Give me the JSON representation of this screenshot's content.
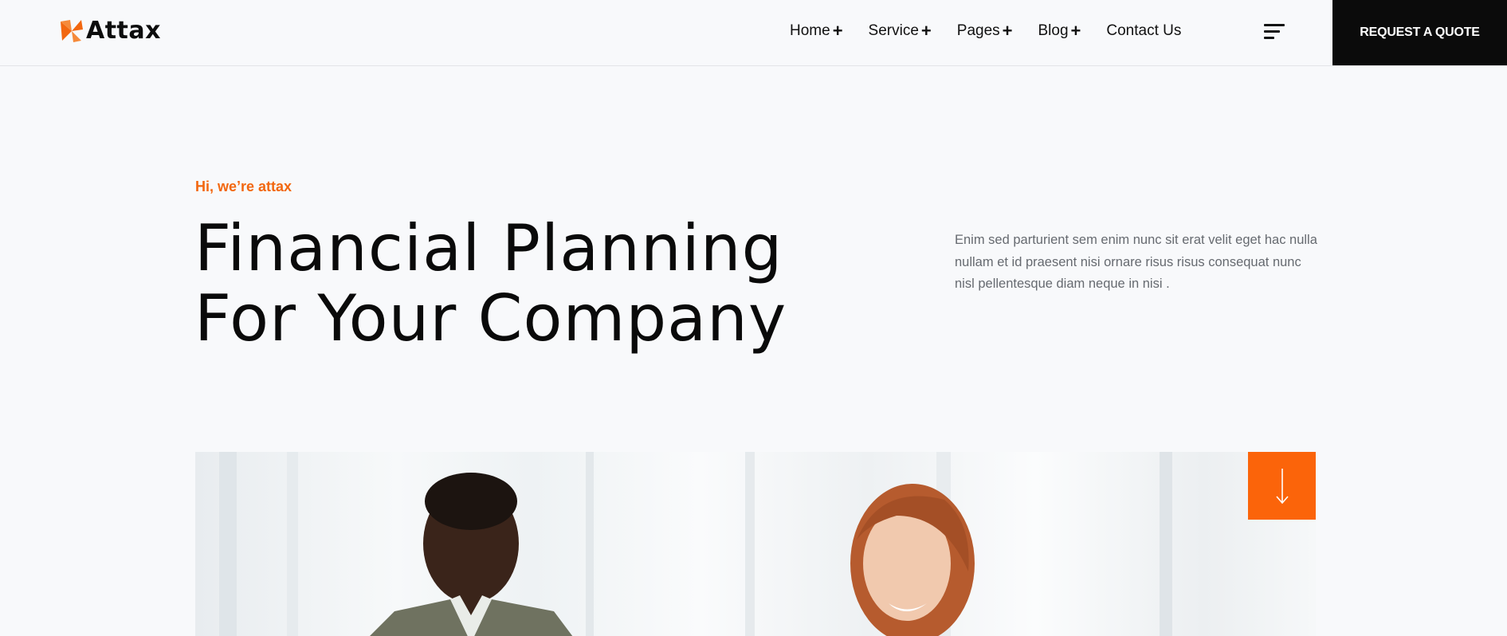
{
  "brand": {
    "name": "Attax",
    "accent": "#f2670f"
  },
  "nav": {
    "items": [
      {
        "label": "Home",
        "has_submenu": true
      },
      {
        "label": "Service",
        "has_submenu": true
      },
      {
        "label": "Pages",
        "has_submenu": true
      },
      {
        "label": "Blog",
        "has_submenu": true
      },
      {
        "label": "Contact Us",
        "has_submenu": false
      }
    ],
    "submenu_marker": "+",
    "menu_icon": "hamburger-menu-icon",
    "cta_label": "REQUEST A QUOTE"
  },
  "hero": {
    "eyebrow": "Hi, we’re attax",
    "title_line1": "Financial Planning",
    "title_line2": "For Your Company",
    "intro": "Enim sed parturient sem enim nunc sit erat velit eget hac nulla nullam et id praesent nisi ornare risus risus consequat nunc nisl pellentesque diam neque in nisi .",
    "scroll_icon": "arrow-down-icon",
    "scroll_color": "#fb640a"
  }
}
